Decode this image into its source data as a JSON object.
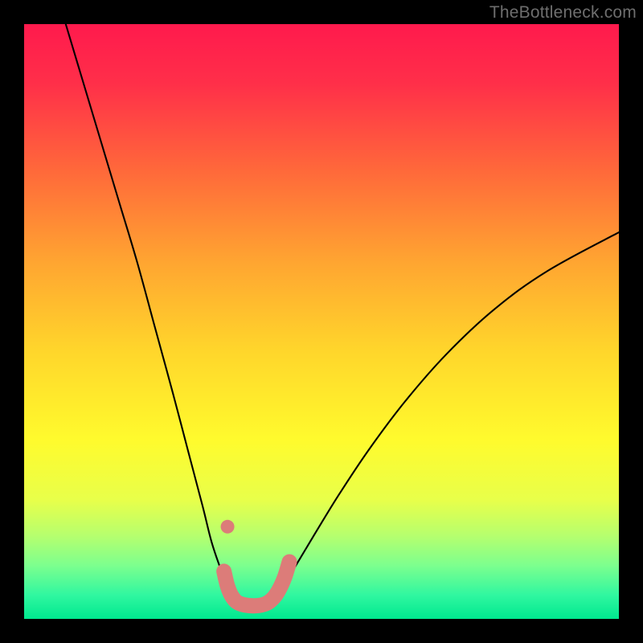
{
  "watermark": "TheBottleneck.com",
  "chart_data": {
    "type": "line",
    "title": "",
    "xlabel": "",
    "ylabel": "",
    "xlim": [
      0,
      100
    ],
    "ylim": [
      0,
      100
    ],
    "background_gradient": {
      "stops": [
        {
          "offset": 0.0,
          "color": "#ff1a4d"
        },
        {
          "offset": 0.1,
          "color": "#ff2f49"
        },
        {
          "offset": 0.25,
          "color": "#ff6a3a"
        },
        {
          "offset": 0.4,
          "color": "#ffa531"
        },
        {
          "offset": 0.55,
          "color": "#ffd62b"
        },
        {
          "offset": 0.7,
          "color": "#fffb2d"
        },
        {
          "offset": 0.8,
          "color": "#e8ff4a"
        },
        {
          "offset": 0.86,
          "color": "#b6ff6e"
        },
        {
          "offset": 0.91,
          "color": "#7dff8e"
        },
        {
          "offset": 0.96,
          "color": "#30f7a0"
        },
        {
          "offset": 1.0,
          "color": "#00e88f"
        }
      ]
    },
    "series": [
      {
        "name": "left-branch",
        "color": "#000000",
        "x": [
          7,
          10,
          13,
          16,
          19,
          22,
          25,
          27.5,
          30,
          31.5,
          33,
          34,
          35,
          35.8
        ],
        "y": [
          100,
          90,
          80,
          70,
          60,
          49,
          38,
          28.5,
          19,
          13,
          8.5,
          5.8,
          4.2,
          3.3
        ]
      },
      {
        "name": "right-branch",
        "color": "#000000",
        "x": [
          41.5,
          42.5,
          44,
          46,
          49,
          53,
          58,
          64,
          71,
          79,
          88,
          100
        ],
        "y": [
          3.3,
          4.2,
          6.2,
          9.5,
          14.5,
          21,
          28.5,
          36.5,
          44.5,
          52,
          58.5,
          65
        ]
      },
      {
        "name": "highlight-dot",
        "type": "scatter",
        "color": "#dc7c79",
        "x": [
          34.2
        ],
        "y": [
          15.5
        ]
      },
      {
        "name": "highlight-band",
        "type": "band",
        "color": "#dc7c79",
        "points": [
          {
            "x": 33.6,
            "y": 8.0
          },
          {
            "x": 34.2,
            "y": 5.5
          },
          {
            "x": 35.0,
            "y": 3.7
          },
          {
            "x": 36.2,
            "y": 2.6
          },
          {
            "x": 38.5,
            "y": 2.2
          },
          {
            "x": 40.5,
            "y": 2.5
          },
          {
            "x": 41.8,
            "y": 3.4
          },
          {
            "x": 42.8,
            "y": 4.8
          },
          {
            "x": 43.8,
            "y": 7.0
          },
          {
            "x": 44.6,
            "y": 9.6
          }
        ]
      }
    ]
  }
}
